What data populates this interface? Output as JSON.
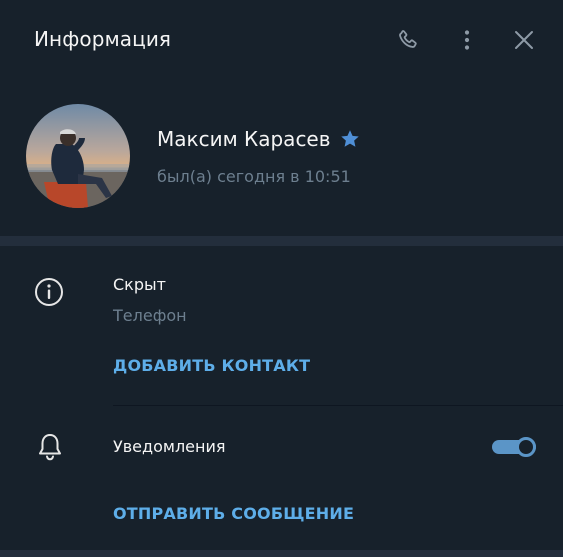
{
  "header": {
    "title": "Информация",
    "icons": [
      "phone-icon",
      "more-vertical-icon",
      "close-icon"
    ]
  },
  "profile": {
    "name": "Максим Карасев",
    "status": "был(а) сегодня в 10:51",
    "badge_icon": "star-icon",
    "badge_color": "#4f8fd6"
  },
  "info": {
    "phone_value": "Скрыт",
    "phone_label": "Телефон",
    "add_contact": "ДОБАВИТЬ КОНТАКТ"
  },
  "notifications": {
    "label": "Уведомления",
    "enabled": true
  },
  "actions": {
    "send_message": "ОТПРАВИТЬ СООБЩЕНИЕ"
  },
  "colors": {
    "background": "#17212b",
    "accent": "#5eaee9",
    "toggle": "#5b95c7",
    "muted_text": "#6d7f8f",
    "text": "#f5f5f5"
  }
}
